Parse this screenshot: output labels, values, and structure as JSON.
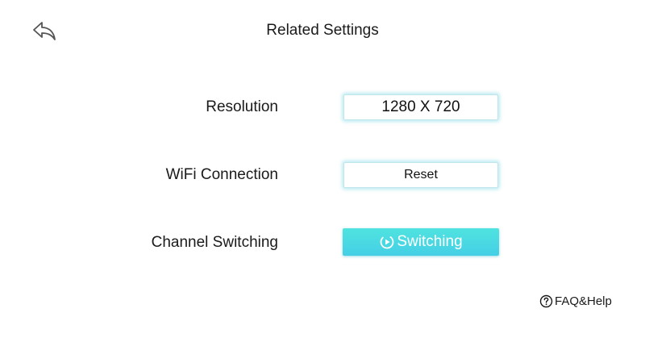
{
  "header": {
    "back_icon": "back-arrow-icon",
    "title": "Related Settings"
  },
  "settings": {
    "resolution": {
      "label": "Resolution",
      "value": "1280 X 720"
    },
    "wifi": {
      "label": "WiFi Connection",
      "button_label": "Reset"
    },
    "channel": {
      "label": "Channel Switching",
      "button_label": "Switching",
      "button_icon": "switch-cycle-icon"
    }
  },
  "footer": {
    "help_label": "FAQ&Help",
    "help_icon": "question-circle-icon"
  },
  "colors": {
    "accent_button_top": "#4fe3df",
    "accent_button_bottom": "#45cfe6",
    "box_glow": "#6ed2e1",
    "text": "#1a1a1a",
    "background": "#ffffff"
  }
}
